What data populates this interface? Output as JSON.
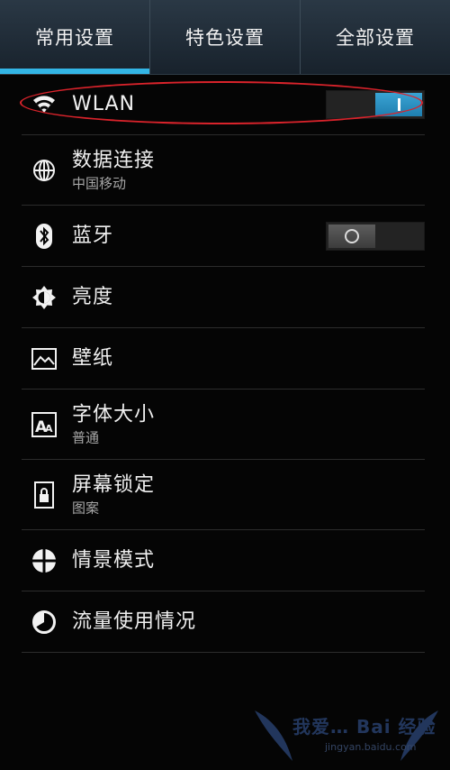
{
  "tabs": [
    {
      "label": "常用设置",
      "active": true
    },
    {
      "label": "特色设置",
      "active": false
    },
    {
      "label": "全部设置",
      "active": false
    }
  ],
  "settings": [
    {
      "label": "WLAN",
      "icon": "wifi-icon",
      "toggle": "on"
    },
    {
      "label": "数据连接",
      "sublabel": "中国移动",
      "icon": "globe-icon"
    },
    {
      "label": "蓝牙",
      "icon": "bluetooth-icon",
      "toggle": "off"
    },
    {
      "label": "亮度",
      "icon": "brightness-icon"
    },
    {
      "label": "壁纸",
      "icon": "wallpaper-icon"
    },
    {
      "label": "字体大小",
      "sublabel": "普通",
      "icon": "font-size-icon"
    },
    {
      "label": "屏幕锁定",
      "sublabel": "图案",
      "icon": "lock-icon"
    },
    {
      "label": "情景模式",
      "icon": "profile-icon"
    },
    {
      "label": "流量使用情况",
      "icon": "data-usage-icon"
    }
  ],
  "watermark": {
    "text": "我爱… Bai 经验",
    "url": "jingyan.baidu.com"
  },
  "colors": {
    "accent": "#33b5e5",
    "annotation": "#d9232b",
    "tab_bg": "#1f2a34"
  }
}
